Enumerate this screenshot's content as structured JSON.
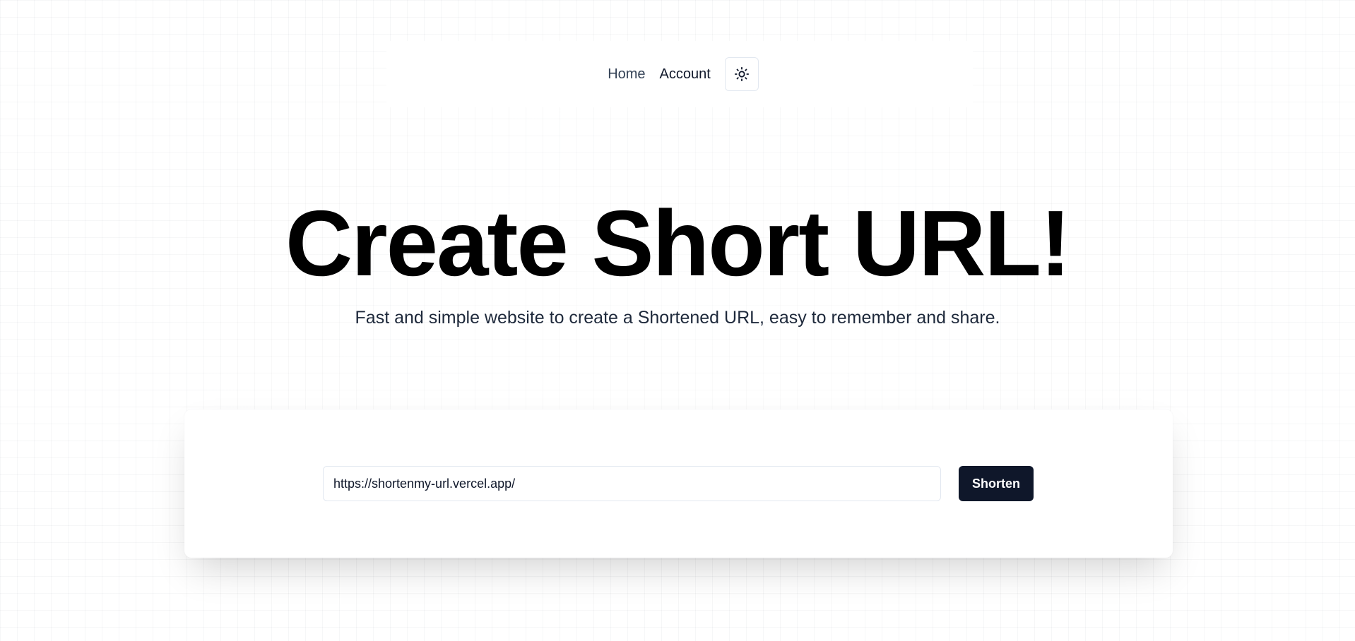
{
  "nav": {
    "home_label": "Home",
    "account_label": "Account",
    "theme_toggle_icon": "sun-icon"
  },
  "hero": {
    "title": "Create Short URL!",
    "subtitle": "Fast and simple website to create a Shortened URL, easy to remember and share."
  },
  "shortener": {
    "url_value": "https://shortenmy-url.vercel.app/",
    "button_label": "Shorten"
  },
  "colors": {
    "primary_button": "#0f172a",
    "background": "#ffffff",
    "grid_line": "#f1f3f6"
  }
}
